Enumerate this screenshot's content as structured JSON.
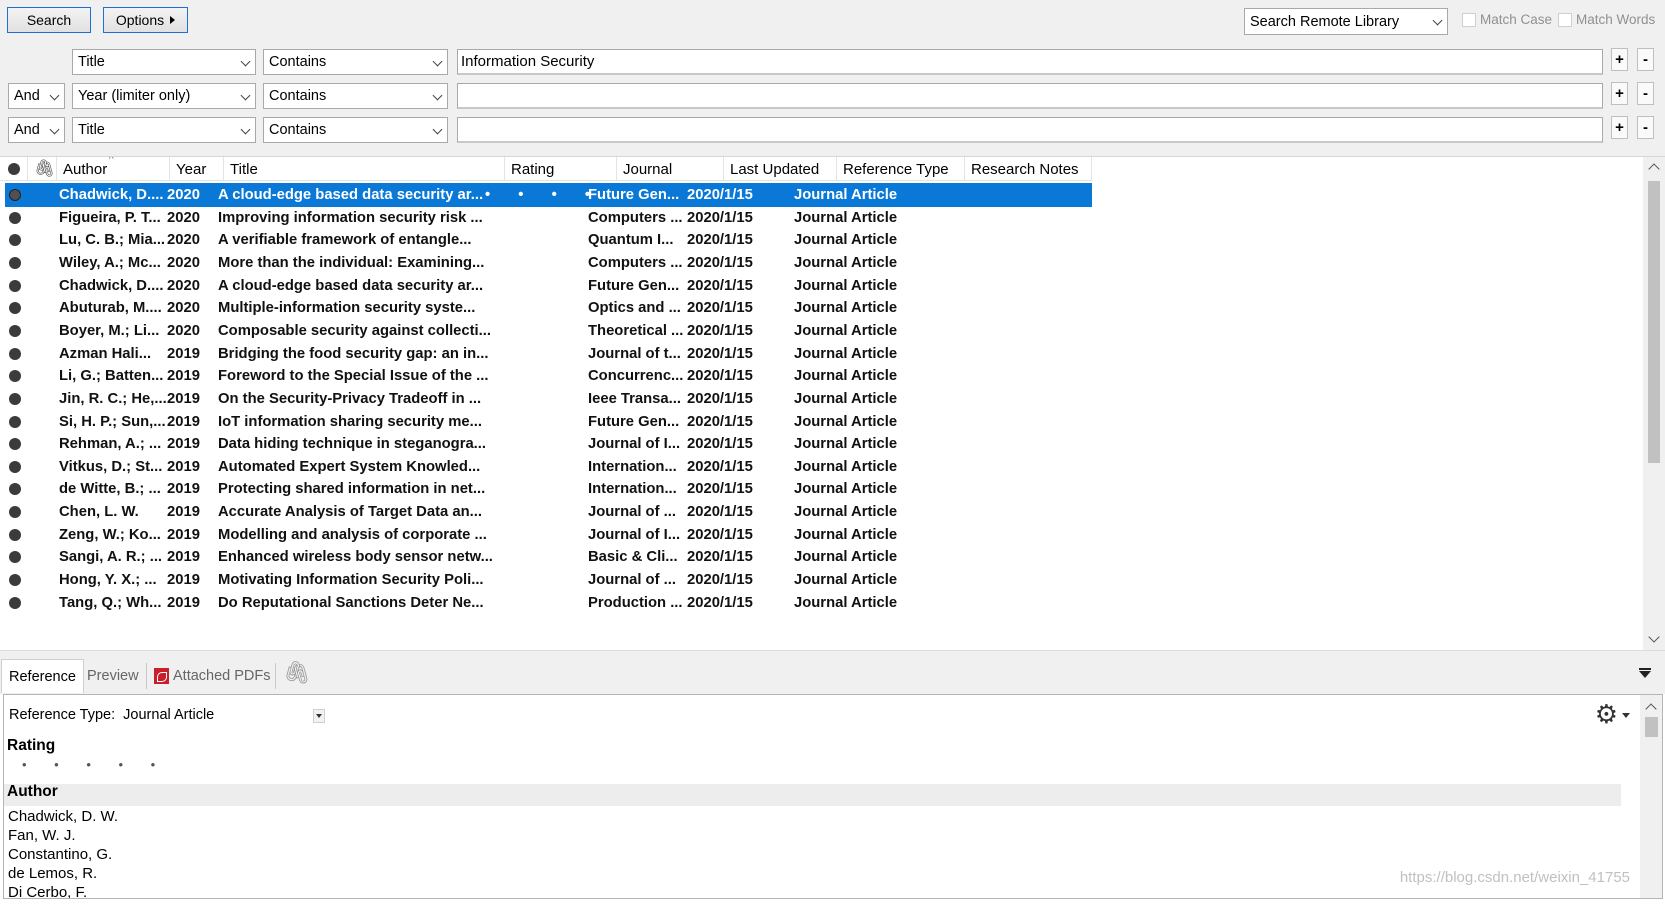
{
  "search": {
    "search_label": "Search",
    "options_label": "Options",
    "library_select": "Search Remote Library",
    "match_case_label": "Match Case",
    "match_words_label": "Match Words",
    "criteria": [
      {
        "bool": "",
        "field": "Title",
        "op": "Contains",
        "value": "Information Security"
      },
      {
        "bool": "And",
        "field": "Year (limiter only)",
        "op": "Contains",
        "value": ""
      },
      {
        "bool": "And",
        "field": "Title",
        "op": "Contains",
        "value": ""
      }
    ],
    "plus": "+",
    "minus": "-"
  },
  "columns": {
    "author": "Author",
    "year": "Year",
    "title": "Title",
    "rating": "Rating",
    "journal": "Journal",
    "last_updated": "Last Updated",
    "reference_type": "Reference Type",
    "research_notes": "Research Notes"
  },
  "rows": [
    {
      "author": "Chadwick, D....",
      "year": "2020",
      "title": "A cloud-edge based data security ar...",
      "rating": "• • • • •",
      "journal": "Future Gen...",
      "updated": "2020/1/15",
      "type": "Journal Article"
    },
    {
      "author": "Figueira, P. T...",
      "year": "2020",
      "title": "Improving information security risk ...",
      "rating": "",
      "journal": "Computers ...",
      "updated": "2020/1/15",
      "type": "Journal Article"
    },
    {
      "author": "Lu, C. B.; Mia...",
      "year": "2020",
      "title": "A verifiable framework of entangle...",
      "rating": "",
      "journal": "Quantum I...",
      "updated": "2020/1/15",
      "type": "Journal Article"
    },
    {
      "author": "Wiley, A.; Mc...",
      "year": "2020",
      "title": "More than the individual: Examining...",
      "rating": "",
      "journal": "Computers ...",
      "updated": "2020/1/15",
      "type": "Journal Article"
    },
    {
      "author": "Chadwick, D....",
      "year": "2020",
      "title": "A cloud-edge based data security ar...",
      "rating": "",
      "journal": "Future Gen...",
      "updated": "2020/1/15",
      "type": "Journal Article"
    },
    {
      "author": "Abuturab, M....",
      "year": "2020",
      "title": "Multiple-information security syste...",
      "rating": "",
      "journal": "Optics and ...",
      "updated": "2020/1/15",
      "type": "Journal Article"
    },
    {
      "author": "Boyer, M.; Li...",
      "year": "2020",
      "title": "Composable security against collecti...",
      "rating": "",
      "journal": "Theoretical ...",
      "updated": "2020/1/15",
      "type": "Journal Article"
    },
    {
      "author": "Azman Hali...",
      "year": "2019",
      "title": "Bridging the food security gap: an in...",
      "rating": "",
      "journal": "Journal of t...",
      "updated": "2020/1/15",
      "type": "Journal Article"
    },
    {
      "author": "Li, G.; Batten...",
      "year": "2019",
      "title": "Foreword to the Special Issue of the ...",
      "rating": "",
      "journal": "Concurrenc...",
      "updated": "2020/1/15",
      "type": "Journal Article"
    },
    {
      "author": "Jin, R. C.; He,...",
      "year": "2019",
      "title": "On the Security-Privacy Tradeoff in ...",
      "rating": "",
      "journal": "Ieee Transa...",
      "updated": "2020/1/15",
      "type": "Journal Article"
    },
    {
      "author": "Si, H. P.; Sun,...",
      "year": "2019",
      "title": "IoT information sharing security me...",
      "rating": "",
      "journal": "Future Gen...",
      "updated": "2020/1/15",
      "type": "Journal Article"
    },
    {
      "author": "Rehman, A.; ...",
      "year": "2019",
      "title": "Data hiding technique in steganogra...",
      "rating": "",
      "journal": "Journal of I...",
      "updated": "2020/1/15",
      "type": "Journal Article"
    },
    {
      "author": "Vitkus, D.; St...",
      "year": "2019",
      "title": "Automated Expert System Knowled...",
      "rating": "",
      "journal": "Internation...",
      "updated": "2020/1/15",
      "type": "Journal Article"
    },
    {
      "author": "de Witte, B.; ...",
      "year": "2019",
      "title": "Protecting shared information in net...",
      "rating": "",
      "journal": "Internation...",
      "updated": "2020/1/15",
      "type": "Journal Article"
    },
    {
      "author": "Chen, L. W.",
      "year": "2019",
      "title": "Accurate Analysis of Target Data an...",
      "rating": "",
      "journal": "Journal of ...",
      "updated": "2020/1/15",
      "type": "Journal Article"
    },
    {
      "author": "Zeng, W.; Ko...",
      "year": "2019",
      "title": "Modelling and analysis of corporate ...",
      "rating": "",
      "journal": "Journal of I...",
      "updated": "2020/1/15",
      "type": "Journal Article"
    },
    {
      "author": "Sangi, A. R.; ...",
      "year": "2019",
      "title": "Enhanced wireless body sensor netw...",
      "rating": "",
      "journal": "Basic & Cli...",
      "updated": "2020/1/15",
      "type": "Journal Article"
    },
    {
      "author": "Hong, Y. X.; ...",
      "year": "2019",
      "title": "Motivating Information Security Poli...",
      "rating": "",
      "journal": "Journal of ...",
      "updated": "2020/1/15",
      "type": "Journal Article"
    },
    {
      "author": "Tang, Q.; Wh...",
      "year": "2019",
      "title": "Do Reputational Sanctions Deter Ne...",
      "rating": "",
      "journal": "Production ...",
      "updated": "2020/1/15",
      "type": "Journal Article"
    }
  ],
  "tabs": {
    "reference": "Reference",
    "preview": "Preview",
    "attached_pdfs": "Attached PDFs"
  },
  "reference": {
    "type_label": "Reference Type:",
    "type_value": "Journal Article",
    "rating_label": "Rating",
    "rating_dots": "• • • • •",
    "author_label": "Author",
    "authors": [
      "Chadwick, D. W.",
      "Fan, W. J.",
      "Constantino, G.",
      "de Lemos, R.",
      "Di Cerbo, F."
    ]
  },
  "watermark": "https://blog.csdn.net/weixin_41755"
}
